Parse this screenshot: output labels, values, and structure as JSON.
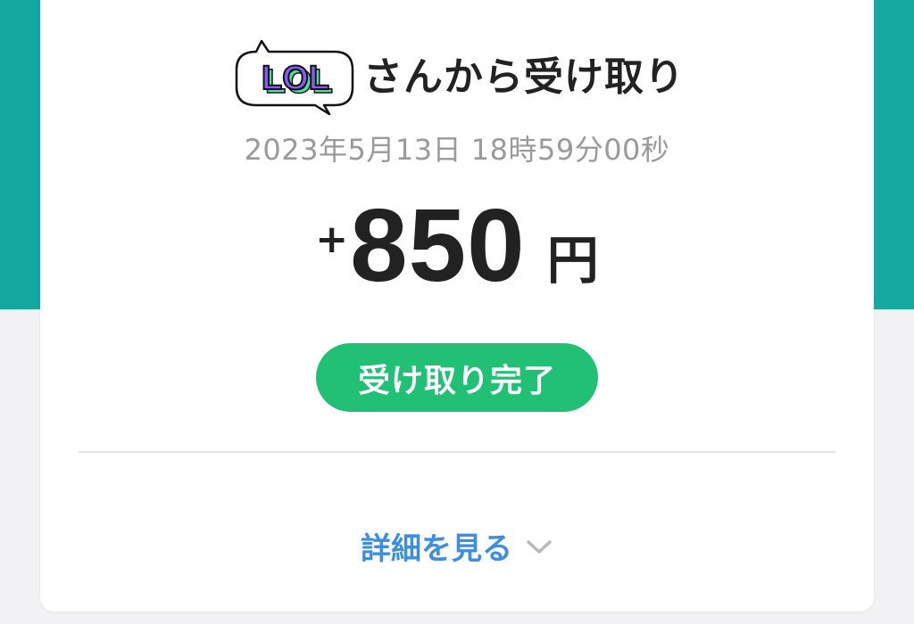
{
  "sender": {
    "avatar_text": "LOL",
    "label": "さんから受け取り"
  },
  "transaction": {
    "timestamp": "2023年5月13日 18時59分00秒",
    "sign": "+",
    "amount": "850",
    "currency": "円",
    "status": "受け取り完了"
  },
  "details": {
    "label": "詳細を見る",
    "icon": "chevron-down-icon"
  },
  "colors": {
    "header_background": "#14aaa2",
    "status_badge": "#22c074",
    "link": "#3b8ee0",
    "avatar_text": "#8a5cf5",
    "avatar_text_shadow": "#4de0a0"
  }
}
